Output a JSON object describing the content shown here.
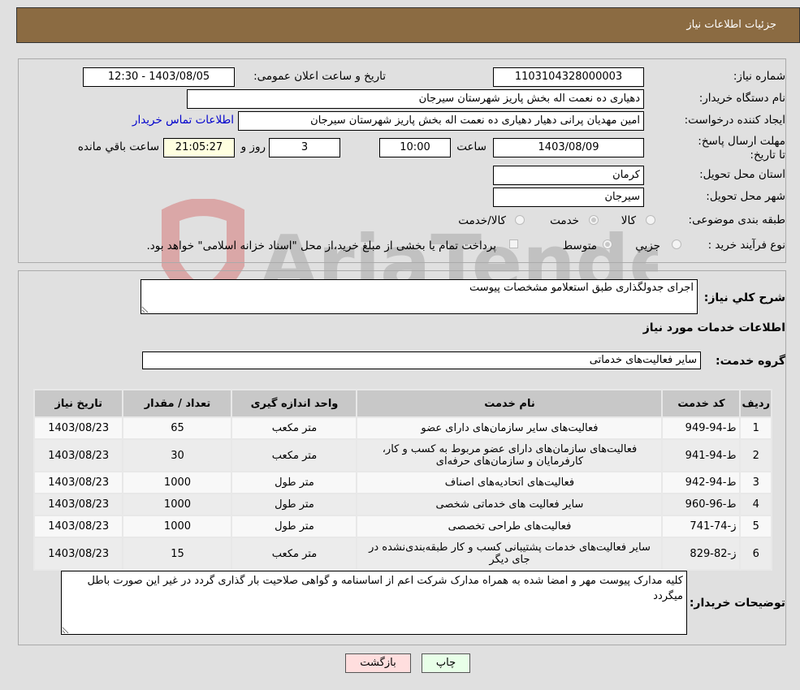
{
  "header": {
    "title": "جزئیات اطلاعات نیاز"
  },
  "form": {
    "need_number": {
      "label": "شماره نیاز:",
      "value": "1103104328000003"
    },
    "announce_datetime": {
      "label": "تاریخ و ساعت اعلان عمومی:",
      "value": "1403/08/05 - 12:30"
    },
    "buyer_org": {
      "label": "نام دستگاه خریدار:",
      "value": "دهیاری ده نعمت اله بخش پاریز شهرستان سیرجان"
    },
    "requester": {
      "label": "ایجاد کننده درخواست:",
      "value": "امین مهدیان پرانی دهیار دهیاری ده نعمت اله بخش پاریز شهرستان سیرجان"
    },
    "contact_link": "اطلاعات تماس خریدار",
    "deadline": {
      "label": "مهلت ارسال پاسخ: تا تاریخ:",
      "date": "1403/08/09",
      "time_label": "ساعت",
      "time": "10:00",
      "days": "3",
      "days_label": "روز و",
      "remaining": "21:05:27",
      "remaining_label": "ساعت باقي مانده"
    },
    "province": {
      "label": "استان محل تحویل:",
      "value": "کرمان"
    },
    "city": {
      "label": "شهر محل تحویل:",
      "value": "سیرجان"
    },
    "category": {
      "label": "طبقه بندی موضوعی:",
      "options": [
        "کالا",
        "خدمت",
        "کالا/خدمت"
      ],
      "selected": "خدمت"
    },
    "process": {
      "label": "نوع فرآیند خرید :",
      "options": [
        "جزیي",
        "متوسط"
      ],
      "selected": "متوسط",
      "note": "پرداخت تمام یا بخشی از مبلغ خرید،از محل \"اسناد خزانه اسلامی\" خواهد بود."
    }
  },
  "details": {
    "description_label": "شرح کلي نیاز:",
    "description": "اجرای جدولگذاری طبق استعلامو مشخصات پیوست",
    "services_title": "اطلاعات خدمات مورد نیاز",
    "service_group_label": "گروه خدمت:",
    "service_group": "سایر فعالیت‌های خدماتی",
    "table": {
      "headers": [
        "ردیف",
        "کد خدمت",
        "نام خدمت",
        "واحد اندازه گیری",
        "تعداد / مقدار",
        "تاریخ نیاز"
      ],
      "rows": [
        [
          "1",
          "ط-94-949",
          "فعالیت‌های سایر سازمان‌های دارای عضو",
          "متر مکعب",
          "65",
          "1403/08/23"
        ],
        [
          "2",
          "ط-94-941",
          "فعالیت‌های سازمان‌های دارای عضو مربوط به کسب و کار، کارفرمایان و سازمان‌های حرفه‌ای",
          "متر مکعب",
          "30",
          "1403/08/23"
        ],
        [
          "3",
          "ط-94-942",
          "فعالیت‌های اتحادیه‌های اصناف",
          "متر طول",
          "1000",
          "1403/08/23"
        ],
        [
          "4",
          "ط-96-960",
          "سایر فعالیت های خدماتی شخصی",
          "متر طول",
          "1000",
          "1403/08/23"
        ],
        [
          "5",
          "ز-74-741",
          "فعالیت‌های طراحی تخصصی",
          "متر طول",
          "1000",
          "1403/08/23"
        ],
        [
          "6",
          "ز-82-829",
          "سایر فعالیت‌های خدمات پشتیبانی کسب و کار طبقه‌بندی‌نشده در جای دیگر",
          "متر مکعب",
          "15",
          "1403/08/23"
        ]
      ]
    },
    "buyer_notes_label": "توضیحات خریدار:",
    "buyer_notes": "کلیه مدارک پیوست مهر و امضا شده به همراه مدارک شرکت اعم از اساسنامه و گواهی صلاحیت بار گذاری گردد در غیر این صورت باطل میگردد"
  },
  "buttons": {
    "print": "چاپ",
    "back": "بازگشت"
  },
  "colors": {
    "header": "#8b6b42",
    "print_btn": "#e8ffe8",
    "back_btn": "#ffdede",
    "link": "#0000cc"
  },
  "watermark": {
    "text": "AriaTender.neT"
  }
}
